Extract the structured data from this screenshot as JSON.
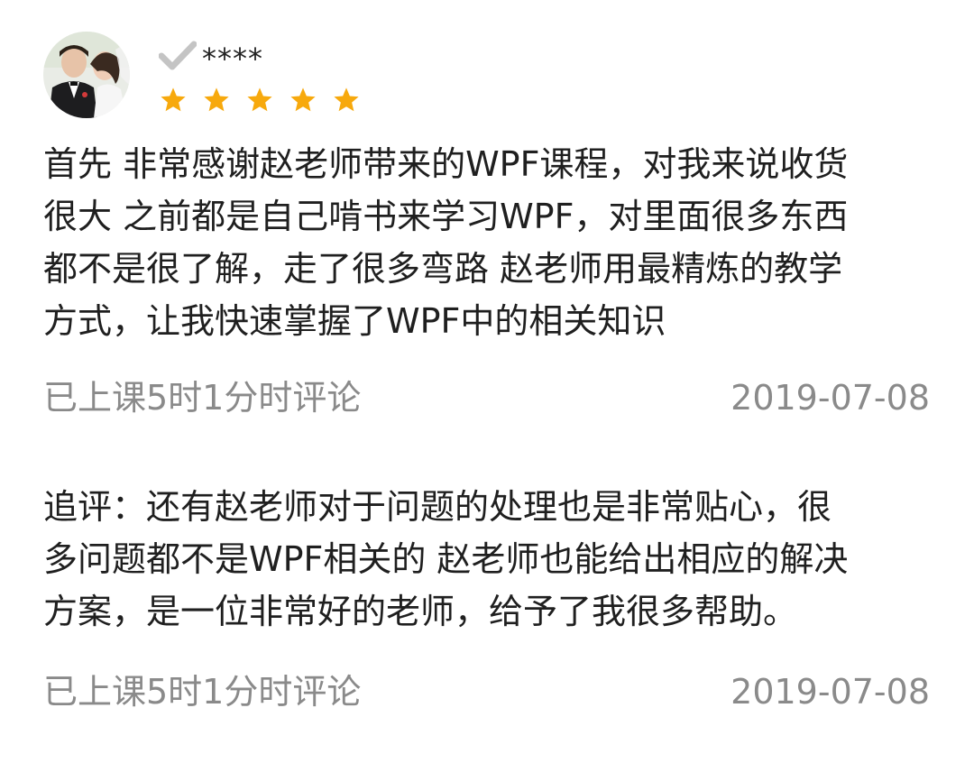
{
  "user": {
    "name": "****",
    "avatar_icon": "user-avatar-photo",
    "verified_icon": "check-icon",
    "rating": 5,
    "rating_max": 5,
    "star_color": "#f7a90d"
  },
  "review": {
    "text": "首先 非常感谢赵老师带来的WPF课程，对我来说收货\n很大 之前都是自己啃书来学习WPF，对里面很多东西\n都不是很了解，走了很多弯路 赵老师用最精炼的教学\n方式，让我快速掌握了WPF中的相关知识",
    "meta_left": "已上课5时1分时评论",
    "meta_right": "2019-07-08"
  },
  "followup": {
    "text": "追评：还有赵老师对于问题的处理也是非常贴心，很\n多问题都不是WPF相关的 赵老师也能给出相应的解决\n方案，是一位非常好的老师，给予了我很多帮助。",
    "meta_left": "已上课5时1分时评论",
    "meta_right": "2019-07-08"
  }
}
